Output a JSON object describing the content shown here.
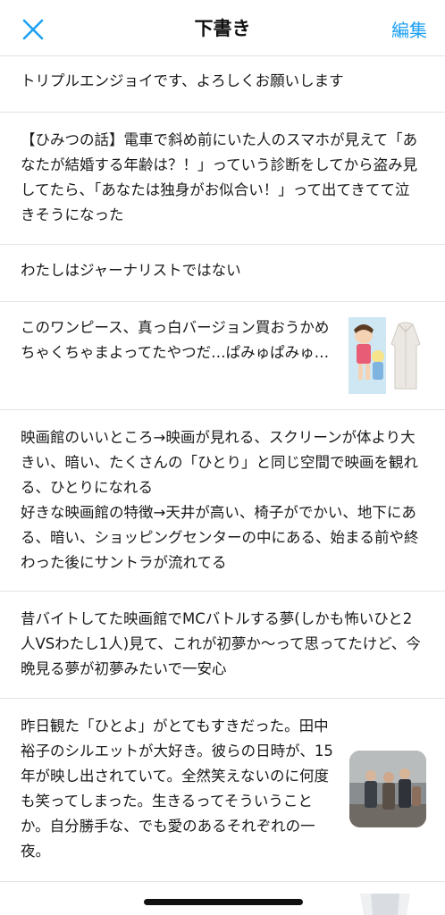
{
  "header": {
    "title": "下書き",
    "edit_label": "編集",
    "close_icon": "close-icon",
    "accent_color": "#1da1f2"
  },
  "drafts": [
    {
      "text": "トリプルエンジョイです、よろしくお願いします"
    },
    {
      "text": "【ひみつの話】電車で斜め前にいた人のスマホが見えて「あなたが結婚する年齢は？！」っていう診断をしてから盗み見してたら、「あなたは独身がお似合い！」って出てきてて泣きそうになった"
    },
    {
      "text": "わたしはジャーナリストではない"
    },
    {
      "text": "このワンピース、真っ白バージョン買おうかめちゃくちゃまよってたやつだ…ぱみゅぱみゅ…",
      "thumbnail": "fashion-collage-image"
    },
    {
      "text": "映画館のいいところ→映画が見れる、スクリーンが体より大きい、暗い、たくさんの「ひとり」と同じ空間で映画を観れる、ひとりになれる\n好きな映画館の特徴→天井が高い、椅子がでかい、地下にある、暗い、ショッピングセンターの中にある、始まる前や終わった後にサントラが流れてる"
    },
    {
      "text": "昔バイトしてた映画館でMCバトルする夢(しかも怖いひと2人VSわたし1人)見て、これが初夢か〜って思ってたけど、今晩見る夢が初夢みたいで一安心"
    },
    {
      "text": "昨日観た「ひとよ」がとてもすきだった。田中裕子のシルエットが大好き。彼らの日時が、15年が映し出されていて。全然笑えないのに何度も笑ってしまった。生きるってそういうことか。自分勝手な、でも愛のあるそれぞれの一夜。",
      "thumbnail": "movie-still-image"
    }
  ]
}
